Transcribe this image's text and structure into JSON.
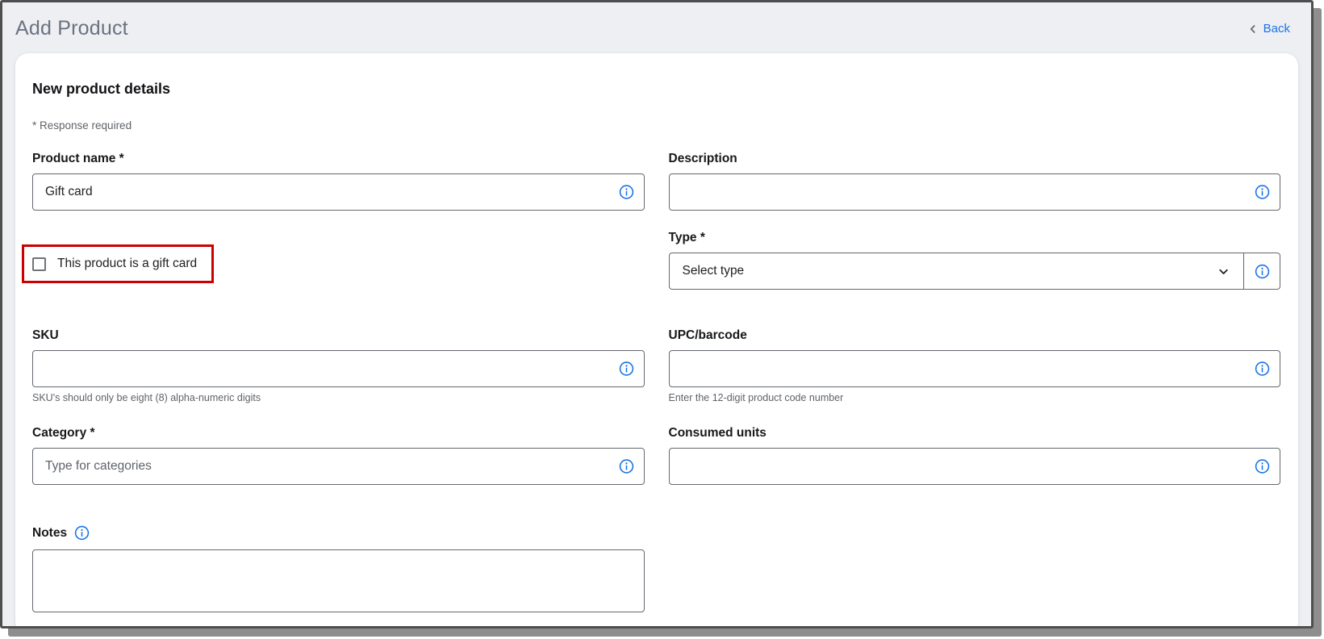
{
  "window": {
    "title": "Add Product",
    "back": {
      "label": "Back"
    }
  },
  "form": {
    "title": "New product details",
    "required_note": "* Response required",
    "product_name": {
      "label": "Product name *",
      "value": "Gift card"
    },
    "description": {
      "label": "Description",
      "value": ""
    },
    "gift_card": {
      "label": "This product is a gift card",
      "checked": false
    },
    "type": {
      "label": "Type *",
      "selected": "Select type"
    },
    "sku": {
      "label": "SKU",
      "value": "",
      "helper": "SKU's should only be eight (8) alpha-numeric digits"
    },
    "upc": {
      "label": "UPC/barcode",
      "value": "",
      "helper": "Enter the 12-digit product code number"
    },
    "category": {
      "label": "Category *",
      "value": "",
      "placeholder": "Type for categories"
    },
    "consumed_units": {
      "label": "Consumed units",
      "value": ""
    },
    "notes": {
      "label": "Notes",
      "value": ""
    }
  },
  "colors": {
    "accent_blue": "#1a73e8",
    "annotation_red": "#cc0000",
    "window_background": "#edeff3"
  }
}
